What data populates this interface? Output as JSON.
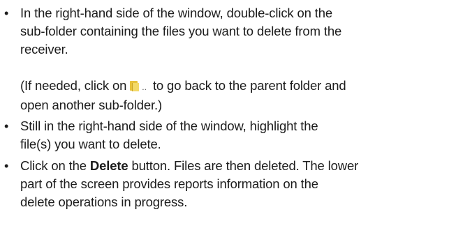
{
  "bullets": [
    {
      "line1": "In the right-hand side of the window, double-click on the",
      "line2": "sub-folder containing the files you want to delete from the",
      "line3": "receiver."
    },
    {
      "line1": "Still in the right-hand side of the window, highlight the",
      "line2": "file(s) you want to delete."
    },
    {
      "line1_pre": "Click on the ",
      "line1_bold": "Delete",
      "line1_post": " button. Files are then deleted. The lower",
      "line2": "part of the screen provides reports information on the",
      "line3": "delete operations in progress."
    }
  ],
  "note": {
    "pre": "(If needed, click on",
    "icon": "parent-folder-icon",
    "dots": "..",
    "post": "to go back to the parent folder and",
    "line2": "open another sub-folder.)"
  }
}
